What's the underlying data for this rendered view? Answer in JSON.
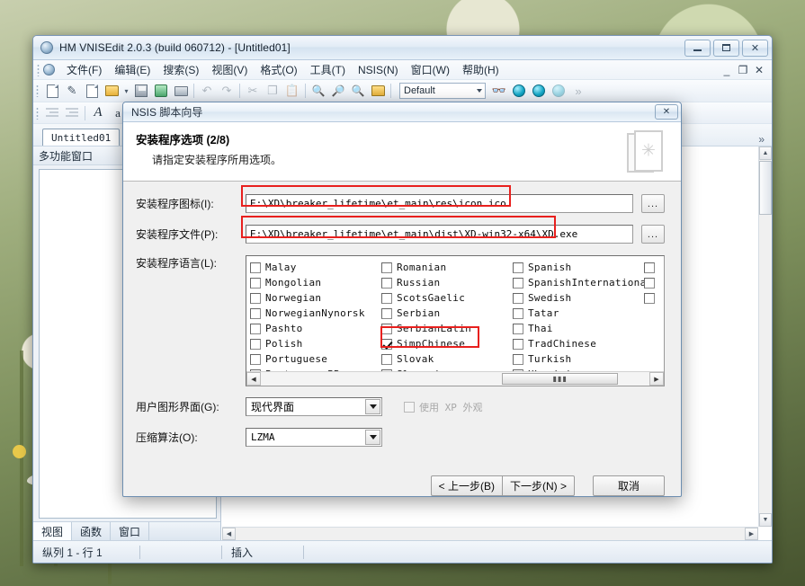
{
  "app": {
    "title": "HM VNISEdit 2.0.3 (build 060712) - [Untitled01]",
    "icon": "app-globe-icon",
    "window_buttons": {
      "minimize": "–",
      "maximize": "❐",
      "close": "✕"
    },
    "mdi_buttons": {
      "minimize": "_",
      "restore": "❐",
      "close": "✕"
    }
  },
  "menu": {
    "items": [
      {
        "label": "文件(F)"
      },
      {
        "label": "编辑(E)"
      },
      {
        "label": "搜索(S)"
      },
      {
        "label": "视图(V)"
      },
      {
        "label": "格式(O)"
      },
      {
        "label": "工具(T)"
      },
      {
        "label": "NSIS(N)"
      },
      {
        "label": "窗口(W)"
      },
      {
        "label": "帮助(H)"
      }
    ]
  },
  "toolbar": {
    "style_combo_value": "Default",
    "overflow": "»"
  },
  "document": {
    "tab_label": "Untitled01",
    "tab_overflow": "»"
  },
  "left_panel": {
    "title": "多功能窗口",
    "tabs": [
      {
        "label": "视图"
      },
      {
        "label": "函数"
      },
      {
        "label": "窗口"
      }
    ]
  },
  "status_bar": {
    "position": "纵列 1 - 行 1",
    "insert_mode": "插入"
  },
  "wizard": {
    "title": "NSIS 脚本向导",
    "close_label": "✕",
    "heading": "安装程序选项  (2/8)",
    "subheading": "请指定安装程序所用选项。",
    "header_icon": "wizard-book-icon",
    "fields": {
      "icon_label": "安装程序图标(I):",
      "icon_value": "E:\\XD\\breaker_lifetime\\et_main\\res\\icon.ico",
      "exe_label": "安装程序文件(P):",
      "exe_value": "E:\\XD\\breaker_lifetime\\et_main\\dist\\XD-win32-x64\\XD.exe",
      "browse_label": "...",
      "lang_label": "安装程序语言(L):",
      "gui_label": "用户图形界面(G):",
      "gui_value": "现代界面",
      "xp_check_label": "使用 XP 外观",
      "xp_check_enabled": false,
      "compressor_label": "压缩算法(O):",
      "compressor_value": "LZMA"
    },
    "languages": {
      "columns": [
        {
          "items": [
            {
              "name": "Malay",
              "checked": false
            },
            {
              "name": "Mongolian",
              "checked": false
            },
            {
              "name": "Norwegian",
              "checked": false
            },
            {
              "name": "NorwegianNynorsk",
              "checked": false
            },
            {
              "name": "Pashto",
              "checked": false
            },
            {
              "name": "Polish",
              "checked": false
            },
            {
              "name": "Portuguese",
              "checked": false
            },
            {
              "name": "PortugueseBR",
              "checked": false
            }
          ]
        },
        {
          "items": [
            {
              "name": "Romanian",
              "checked": false
            },
            {
              "name": "Russian",
              "checked": false
            },
            {
              "name": "ScotsGaelic",
              "checked": false
            },
            {
              "name": "Serbian",
              "checked": false
            },
            {
              "name": "SerbianLatin",
              "checked": false
            },
            {
              "name": "SimpChinese",
              "checked": true
            },
            {
              "name": "Slovak",
              "checked": false
            },
            {
              "name": "Slovenian",
              "checked": false
            }
          ]
        },
        {
          "items": [
            {
              "name": "Spanish",
              "checked": false
            },
            {
              "name": "SpanishInternational",
              "checked": false
            },
            {
              "name": "Swedish",
              "checked": false
            },
            {
              "name": "Tatar",
              "checked": false
            },
            {
              "name": "Thai",
              "checked": false
            },
            {
              "name": "TradChinese",
              "checked": false
            },
            {
              "name": "Turkish",
              "checked": false
            },
            {
              "name": "Ukrainian",
              "checked": false
            }
          ]
        },
        {
          "partial": true,
          "items": [
            {
              "name": "",
              "checked": false
            },
            {
              "name": "",
              "checked": false
            },
            {
              "name": "",
              "checked": false
            }
          ]
        }
      ],
      "scroll_thumb_glyph": "▮▮▮"
    },
    "buttons": {
      "back": "< 上一步(B)",
      "next": "下一步(N) >",
      "cancel": "取消"
    }
  },
  "annotations": {
    "accent_color": "#e8201e",
    "boxes": [
      {
        "name": "icon-path-highlight"
      },
      {
        "name": "exe-path-highlight"
      },
      {
        "name": "simpchinese-highlight"
      }
    ]
  }
}
